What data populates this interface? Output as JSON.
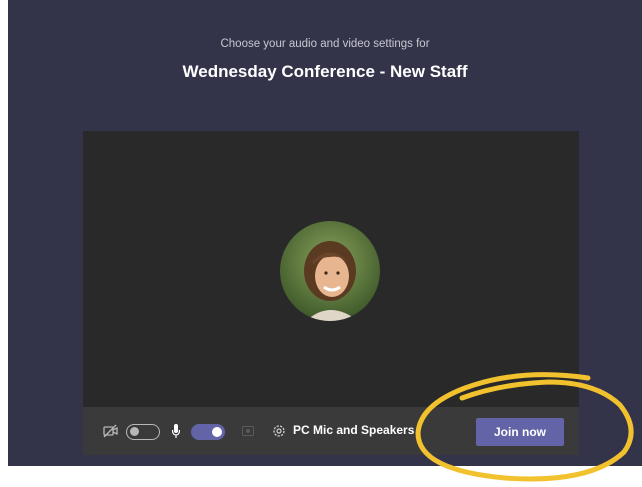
{
  "prejoin": {
    "subtitle": "Choose your audio and video settings for",
    "meeting_title": "Wednesday Conference - New Staff"
  },
  "controls": {
    "camera_icon": "camera-off-icon",
    "camera_toggle": "off",
    "mic_icon": "microphone-icon",
    "mic_toggle": "on",
    "blur_icon": "background-blur-icon",
    "audio_settings_icon": "gear-icon",
    "audio_device_label": "PC Mic and Speakers",
    "join_label": "Join now"
  },
  "colors": {
    "stage_bg": "#33344a",
    "video_bg": "#292929",
    "accent": "#6264a7",
    "annotation": "#f2c12e"
  }
}
